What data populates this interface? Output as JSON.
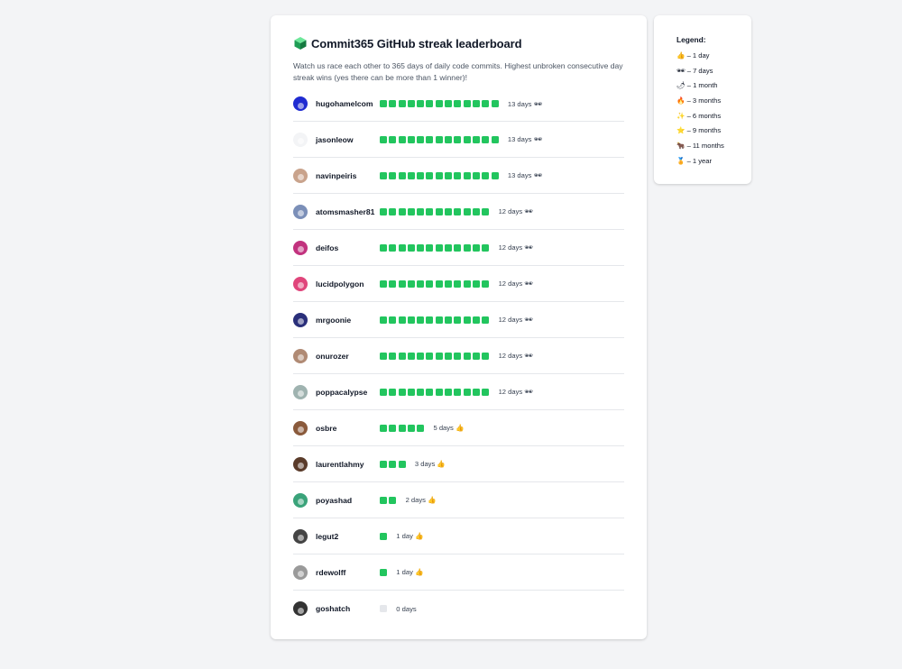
{
  "board": {
    "title": "Commit365 GitHub streak leaderboard",
    "icon": "green-cube-icon",
    "description": "Watch us race each other to 365 days of daily code commits. Highest unbroken consecutive day streak wins (yes there can be more than 1 winner)!"
  },
  "users": [
    {
      "name": "hugohamelcom",
      "days": 13,
      "streak_label": "13 days 🕶",
      "avatar_color": "#1f2bd1"
    },
    {
      "name": "jasonleow",
      "days": 13,
      "streak_label": "13 days 🕶",
      "avatar_color": "#f3f4f6"
    },
    {
      "name": "navinpeiris",
      "days": 13,
      "streak_label": "13 days 🕶",
      "avatar_color": "#c9a38c"
    },
    {
      "name": "atomsmasher81",
      "days": 12,
      "streak_label": "12 days 🕶",
      "avatar_color": "#7b8fb8"
    },
    {
      "name": "deifos",
      "days": 12,
      "streak_label": "12 days 🕶",
      "avatar_color": "#c2327e"
    },
    {
      "name": "lucidpolygon",
      "days": 12,
      "streak_label": "12 days 🕶",
      "avatar_color": "#e0457b"
    },
    {
      "name": "mrgoonie",
      "days": 12,
      "streak_label": "12 days 🕶",
      "avatar_color": "#2a2f7a"
    },
    {
      "name": "onurozer",
      "days": 12,
      "streak_label": "12 days 🕶",
      "avatar_color": "#b08a74"
    },
    {
      "name": "poppacalypse",
      "days": 12,
      "streak_label": "12 days 🕶",
      "avatar_color": "#9fb3b0"
    },
    {
      "name": "osbre",
      "days": 5,
      "streak_label": "5 days 👍",
      "avatar_color": "#8a5a3c"
    },
    {
      "name": "laurentlahmy",
      "days": 3,
      "streak_label": "3 days 👍",
      "avatar_color": "#5a3b2a"
    },
    {
      "name": "poyashad",
      "days": 2,
      "streak_label": "2 days 👍",
      "avatar_color": "#3aa37a"
    },
    {
      "name": "legut2",
      "days": 1,
      "streak_label": "1 day 👍",
      "avatar_color": "#444444"
    },
    {
      "name": "rdewolff",
      "days": 1,
      "streak_label": "1 day 👍",
      "avatar_color": "#9a9a9a"
    },
    {
      "name": "goshatch",
      "days": 0,
      "streak_label": "0 days",
      "avatar_color": "#333333"
    }
  ],
  "colors": {
    "streak_fill": "#22c55e",
    "streak_empty": "#e5e7eb"
  },
  "legend": {
    "title": "Legend:",
    "items": [
      "👍 – 1 day",
      "🕶 – 7 days",
      "🌶 – 1 month",
      "🔥 – 3 months",
      "✨ – 6 months",
      "⭐ – 9 months",
      "🐂 – 11 months",
      "🏅 – 1 year"
    ]
  }
}
